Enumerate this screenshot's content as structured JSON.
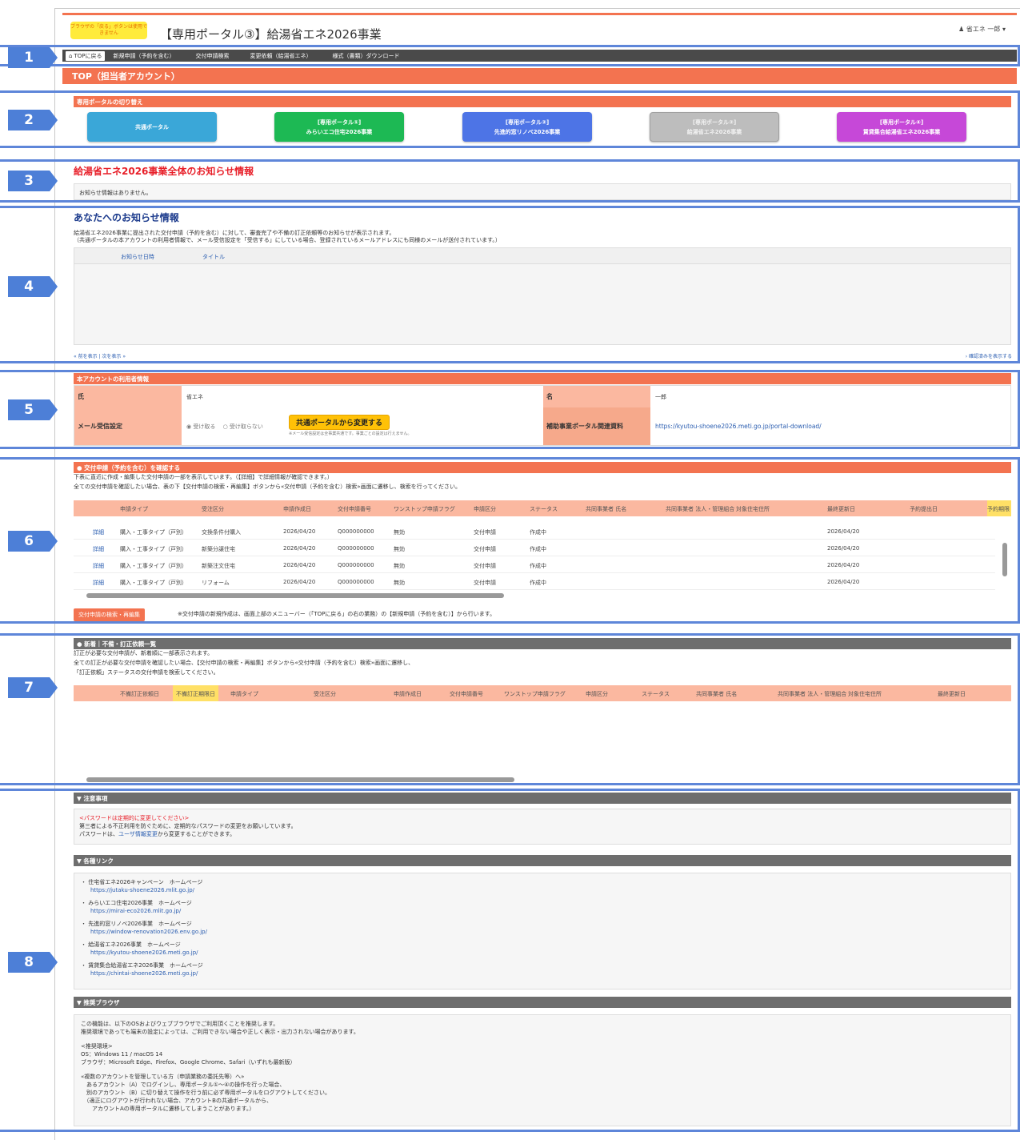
{
  "header": {
    "warning": "ブラウザの「戻る」ボタンは使用できません",
    "title": "【専用ポータル③】給湯省エネ2026事業",
    "user": "省エネ 一郎"
  },
  "nav": {
    "home": "TOPに戻る",
    "items": [
      "新規申請（予約を含む）",
      "交付申請検索",
      "変更依頼（給湯省エネ）",
      "様式（書類）ダウンロード"
    ]
  },
  "top_strip": "TOP（担当者アカウント）",
  "callouts": [
    "1",
    "2",
    "3",
    "4",
    "5",
    "6",
    "7",
    "8"
  ],
  "portal_switch": {
    "heading": "専用ポータルの切り替え",
    "buttons": [
      {
        "line1": "",
        "line2": "共通ポータル",
        "color": "#3aa7d8"
      },
      {
        "line1": "[専用ポータル①]",
        "line2": "みらいエコ住宅2026事業",
        "color": "#1db954"
      },
      {
        "line1": "[専用ポータル②]",
        "line2": "先進的窓リノベ2026事業",
        "color": "#4d74e6"
      },
      {
        "line1": "[専用ポータル③]",
        "line2": "給湯省エネ2026事業",
        "color": "#bdbdbd"
      },
      {
        "line1": "[専用ポータル④]",
        "line2": "賃貸集合給湯省エネ2026事業",
        "color": "#c648d8"
      }
    ]
  },
  "notice_all": {
    "title": "給湯省エネ2026事業全体のお知らせ情報",
    "body": "お知らせ情報はありません。"
  },
  "notice_you": {
    "title": "あなたへのお知らせ情報",
    "desc1": "給湯省エネ2026事業に提出された交付申請（予約を含む）に対して、審査完了や不備の訂正依頼等のお知らせが表示されます。",
    "desc2": "（共通ポータルの本アカウントの利用者情報で、メール受信設定を「受信する」にしている場合、登録されているメールアドレスにも同様のメールが送付されています。）",
    "col_date": "お知らせ日時",
    "col_title": "タイトル",
    "pager": "« 前を表示 | 次を表示 »",
    "show_unread": "› 確認済みを表示する"
  },
  "account": {
    "heading": "本アカウントの利用者情報",
    "last_name_label": "氏",
    "last_name": "省エネ",
    "first_name_label": "名",
    "first_name": "一郎",
    "mail_label": "メール受信設定",
    "receive": "受け取る",
    "not_receive": "受け取らない",
    "change_btn": "共通ポータルから変更する",
    "mail_note": "※メール受信設定は全事業共通です。事業ごとの設定は行えません。",
    "docs_label": "補助事業ポータル関連資料",
    "docs_url": "https://kyutou-shoene2026.meti.go.jp/portal-download/"
  },
  "applications": {
    "heading": "● 交付申請（予約を含む）を確認する",
    "desc1": "下表に直近に作成・編集した交付申請の一部を表示しています。（【詳細】で詳細情報が確認できます。）",
    "desc2": "全ての交付申請を確認したい場合、表の下【交付申請の検索・再編集】ボタンから«交付申請（予約を含む）検索»画面に遷移し、検索を行ってください。",
    "columns": [
      "申請タイプ",
      "受注区分",
      "申請作成日",
      "交付申請番号",
      "ワンストップ申請フラグ",
      "申請区分",
      "ステータス",
      "共同事業者 氏名",
      "共同事業者 法人・管理組合",
      "対象住宅住所",
      "最終更新日",
      "予約提出日",
      "予約期限"
    ],
    "rows": [
      {
        "detail": "詳細",
        "type": "購入・工事タイプ（戸別）",
        "order": "交換条件付購入",
        "created": "2026/04/20",
        "number": "Q000000000",
        "flag": "無効",
        "kind": "交付申請",
        "status": "作成中",
        "updated": "2026/04/20"
      },
      {
        "detail": "詳細",
        "type": "購入・工事タイプ（戸別）",
        "order": "新築分譲住宅",
        "created": "2026/04/20",
        "number": "Q000000000",
        "flag": "無効",
        "kind": "交付申請",
        "status": "作成中",
        "updated": "2026/04/20"
      },
      {
        "detail": "詳細",
        "type": "購入・工事タイプ（戸別）",
        "order": "新築注文住宅",
        "created": "2026/04/20",
        "number": "Q000000000",
        "flag": "無効",
        "kind": "交付申請",
        "status": "作成中",
        "updated": "2026/04/20"
      },
      {
        "detail": "詳細",
        "type": "購入・工事タイプ（戸別）",
        "order": "リフォーム",
        "created": "2026/04/20",
        "number": "Q000000000",
        "flag": "無効",
        "kind": "交付申請",
        "status": "作成中",
        "updated": "2026/04/20"
      }
    ],
    "search_btn": "交付申請の検索・再編集",
    "note": "※交付申請の新規作成は、画面上部のメニューバー（「TOPに戻る」の右の業務）の【新規申請（予約を含む）】から行います。"
  },
  "corrections": {
    "heading": "● 新着｜不備・訂正依頼一覧",
    "desc1": "訂正が必要な交付申請が、新着順に一部表示されます。",
    "desc2": "全ての訂正が必要な交付申請を確認したい場合、【交付申請の検索・再編集】ボタンから«交付申請（予約を含む）検索»画面に遷移し、",
    "desc3": "「訂正依頼」ステータスの交付申請を検索してください。",
    "columns": [
      "不備訂正依頼日",
      "不備訂正期限日",
      "申請タイプ",
      "受注区分",
      "申請作成日",
      "交付申請番号",
      "ワンストップ申請フラグ",
      "申請区分",
      "ステータス",
      "共同事業者 氏名",
      "共同事業者 法人・管理組合",
      "対象住宅住所",
      "最終更新日"
    ]
  },
  "caution": {
    "heading": "▼ 注意事項",
    "red": "<パスワードは定期的に変更してください>",
    "line1": "第三者による不正利用を防ぐために、定期的なパスワードの変更をお願いしています。",
    "line2a": "パスワードは、",
    "line2link": "ユーザ情報変更",
    "line2b": "から変更することができます。"
  },
  "links": {
    "heading": "▼ 各種リンク",
    "items": [
      {
        "name": "住宅省エネ2026キャンペーン　ホームページ",
        "url": "https://jutaku-shoene2026.mlit.go.jp/"
      },
      {
        "name": "みらいエコ住宅2026事業　ホームページ",
        "url": "https://mirai-eco2026.mlit.go.jp/"
      },
      {
        "name": "先進的窓リノベ2026事業　ホームページ",
        "url": "https://window-renovation2026.env.go.jp/"
      },
      {
        "name": "給湯省エネ2026事業　ホームページ",
        "url": "https://kyutou-shoene2026.meti.go.jp/"
      },
      {
        "name": "賃貸集合給湯省エネ2026事業　ホームページ",
        "url": "https://chintai-shoene2026.meti.go.jp/"
      }
    ]
  },
  "browser": {
    "heading": "▼ 推奨ブラウザ",
    "lines": [
      "この機能は、以下のOSおよびウェブブラウザでご利用頂くことを推奨します。",
      "推奨環境であっても端末の設定によっては、ご利用できない場合や正しく表示・出力されない場合があります。",
      "",
      "<推奨環境>",
      "OS：Windows 11 / macOS 14",
      "ブラウザ：Microsoft Edge、Firefox、Google Chrome、Safari（いずれも最新版）",
      "",
      "«複数のアカウントを管理している方（申請業務の委託先等）へ»",
      "　あるアカウント（A）でログインし、専用ポータル①～④の操作を行った場合、",
      "　別のアカウント（B）に切り替えて操作を行う前に必ず専用ポータルをログアウトしてください。",
      "　（適正にログアウトが行われない場合、アカウントBの共通ポータルから、",
      "　　アカウントAの専用ポータルに遷移してしまうことがあります。）"
    ]
  }
}
